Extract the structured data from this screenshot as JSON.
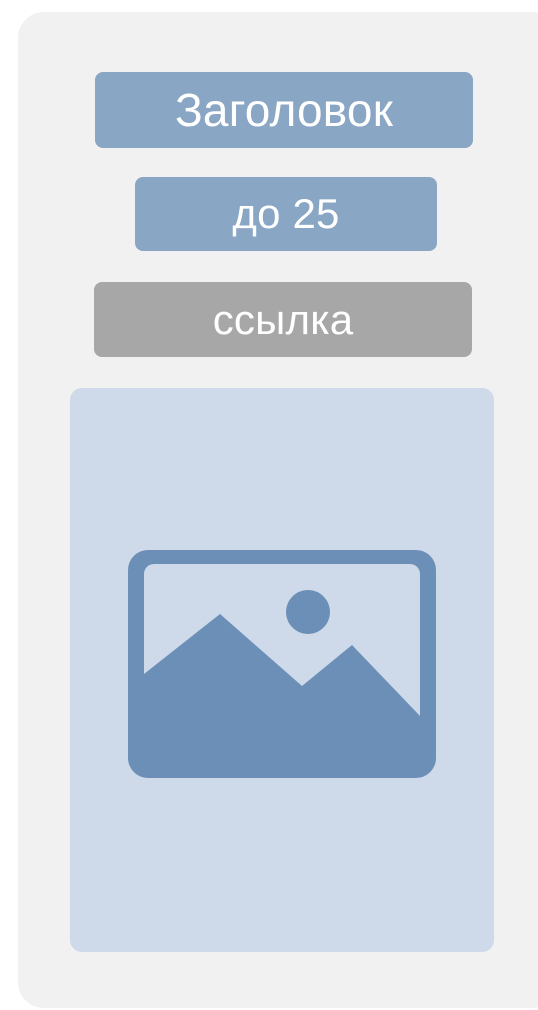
{
  "card": {
    "title_label": "Заголовок",
    "limit_label": "до 25",
    "link_label": "ссылка",
    "image_icon": "image-placeholder-icon"
  },
  "colors": {
    "card_background": "#f1f1f2",
    "title_background": "#89a6c4",
    "limit_background": "#89a6c4",
    "link_background": "#a7a7a7",
    "image_background": "#ced9ea",
    "icon_color": "#6b8fb6",
    "text_color": "#ffffff"
  }
}
